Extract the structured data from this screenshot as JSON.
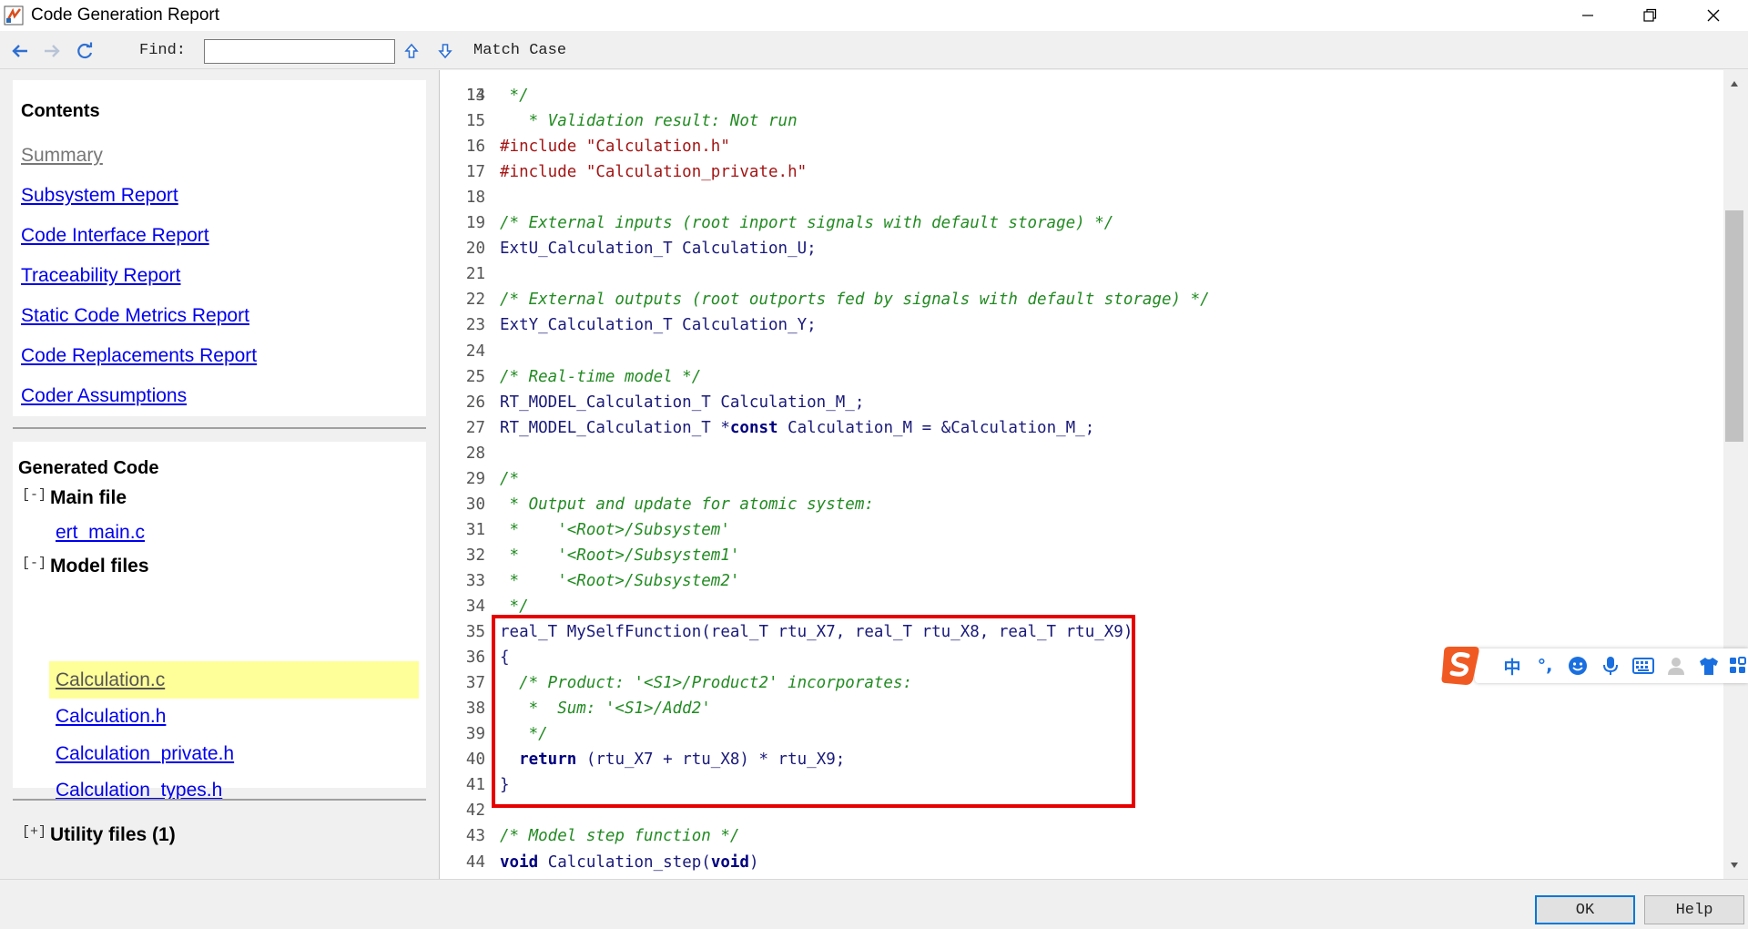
{
  "window": {
    "title": "Code Generation Report",
    "icon": "matlab-report-icon",
    "controls": [
      "minimize-icon",
      "restore-icon",
      "close-icon"
    ]
  },
  "toolbar": {
    "back_icon": "back-arrow-icon",
    "forward_icon": "forward-arrow-icon",
    "refresh_icon": "refresh-icon",
    "find_label": "Find:",
    "find_value": "",
    "find_prev_icon": "up-arrow-icon",
    "find_next_icon": "down-arrow-icon",
    "match_case_label": "Match Case"
  },
  "contents": {
    "title": "Contents",
    "links": [
      {
        "label": "Summary",
        "visited": true
      },
      {
        "label": "Subsystem Report"
      },
      {
        "label": "Code Interface Report"
      },
      {
        "label": "Traceability Report"
      },
      {
        "label": "Static Code Metrics Report"
      },
      {
        "label": "Code Replacements Report"
      },
      {
        "label": "Coder Assumptions"
      }
    ]
  },
  "generated_code": {
    "title": "Generated Code",
    "groups": [
      {
        "toggle": "[-]",
        "title": "Main file",
        "files": [
          "ert_main.c"
        ]
      },
      {
        "toggle": "[-]",
        "title": "Model files",
        "files": [
          "Calculation.c",
          "Calculation.h",
          "Calculation_private.h",
          "Calculation_types.h"
        ],
        "selected": "Calculation.c"
      },
      {
        "toggle": "[+]",
        "title": "Utility files (1)",
        "files": []
      }
    ]
  },
  "code": {
    "partial_top_line": "   * Validation result: Not run",
    "lines": [
      {
        "n": "14",
        "segs": [
          {
            "t": " */",
            "c": "cmt"
          }
        ]
      },
      {
        "n": "15",
        "segs": []
      },
      {
        "n": "16",
        "segs": [
          {
            "t": "#include \"Calculation.h\"",
            "c": "pre"
          }
        ]
      },
      {
        "n": "17",
        "segs": [
          {
            "t": "#include \"Calculation_private.h\"",
            "c": "pre"
          }
        ]
      },
      {
        "n": "18",
        "segs": []
      },
      {
        "n": "19",
        "segs": [
          {
            "t": "/* External inputs (root inport signals with default storage) */",
            "c": "cmt"
          }
        ]
      },
      {
        "n": "20",
        "segs": [
          {
            "t": "ExtU_Calculation_T Calculation_U;",
            "c": ""
          }
        ]
      },
      {
        "n": "21",
        "segs": []
      },
      {
        "n": "22",
        "segs": [
          {
            "t": "/* External outputs (root outports fed by signals with default storage) */",
            "c": "cmt"
          }
        ]
      },
      {
        "n": "23",
        "segs": [
          {
            "t": "ExtY_Calculation_T Calculation_Y;",
            "c": ""
          }
        ]
      },
      {
        "n": "24",
        "segs": []
      },
      {
        "n": "25",
        "segs": [
          {
            "t": "/* Real-time model */",
            "c": "cmt"
          }
        ]
      },
      {
        "n": "26",
        "segs": [
          {
            "t": "RT_MODEL_Calculation_T Calculation_M_;",
            "c": ""
          }
        ]
      },
      {
        "n": "27",
        "segs": [
          {
            "t": "RT_MODEL_Calculation_T *",
            "c": ""
          },
          {
            "t": "const",
            "c": "kw"
          },
          {
            "t": " Calculation_M = &Calculation_M_;",
            "c": ""
          }
        ]
      },
      {
        "n": "28",
        "segs": []
      },
      {
        "n": "29",
        "segs": [
          {
            "t": "/*",
            "c": "cmt"
          }
        ]
      },
      {
        "n": "30",
        "segs": [
          {
            "t": " * Output and update for atomic system:",
            "c": "cmt"
          }
        ]
      },
      {
        "n": "31",
        "segs": [
          {
            "t": " *    '<Root>/Subsystem'",
            "c": "cmt"
          }
        ]
      },
      {
        "n": "32",
        "segs": [
          {
            "t": " *    '<Root>/Subsystem1'",
            "c": "cmt"
          }
        ]
      },
      {
        "n": "33",
        "segs": [
          {
            "t": " *    '<Root>/Subsystem2'",
            "c": "cmt"
          }
        ]
      },
      {
        "n": "34",
        "segs": [
          {
            "t": " */",
            "c": "cmt"
          }
        ]
      },
      {
        "n": "35",
        "segs": [
          {
            "t": "real_T MySelfFunction(real_T rtu_X7, real_T rtu_X8, real_T rtu_X9)",
            "c": ""
          }
        ]
      },
      {
        "n": "36",
        "segs": [
          {
            "t": "{",
            "c": ""
          }
        ]
      },
      {
        "n": "37",
        "segs": [
          {
            "t": "  /* Product: '<S1>/Product2' incorporates:",
            "c": "cmt"
          }
        ]
      },
      {
        "n": "38",
        "segs": [
          {
            "t": "   *  Sum: '<S1>/Add2'",
            "c": "cmt"
          }
        ]
      },
      {
        "n": "39",
        "segs": [
          {
            "t": "   */",
            "c": "cmt"
          }
        ]
      },
      {
        "n": "40",
        "segs": [
          {
            "t": "  ",
            "c": ""
          },
          {
            "t": "return",
            "c": "kw"
          },
          {
            "t": " (rtu_X7 + rtu_X8) * rtu_X9;",
            "c": ""
          }
        ]
      },
      {
        "n": "41",
        "segs": [
          {
            "t": "}",
            "c": ""
          }
        ]
      },
      {
        "n": "42",
        "segs": []
      },
      {
        "n": "43",
        "segs": [
          {
            "t": "/* Model step function */",
            "c": "cmt"
          }
        ]
      },
      {
        "n": "44",
        "segs": [
          {
            "t": "void",
            "c": "kw"
          },
          {
            "t": " Calculation_step(",
            "c": ""
          },
          {
            "t": "void",
            "c": "kw"
          },
          {
            "t": ")",
            "c": ""
          }
        ]
      }
    ],
    "highlight_color": "#e60000"
  },
  "ime": {
    "logo": "sogou-logo-icon",
    "items": [
      {
        "name": "chinese-mode",
        "text": "中"
      },
      {
        "name": "punctuation",
        "text": "°,"
      },
      {
        "name": "emoji-icon",
        "text": ""
      },
      {
        "name": "microphone-icon",
        "text": ""
      },
      {
        "name": "keyboard-icon",
        "text": ""
      },
      {
        "name": "user-icon",
        "text": ""
      },
      {
        "name": "skin-shirt-icon",
        "text": ""
      },
      {
        "name": "toolbox-grid-icon",
        "text": ""
      }
    ]
  },
  "buttons": {
    "ok": "OK",
    "help": "Help"
  }
}
